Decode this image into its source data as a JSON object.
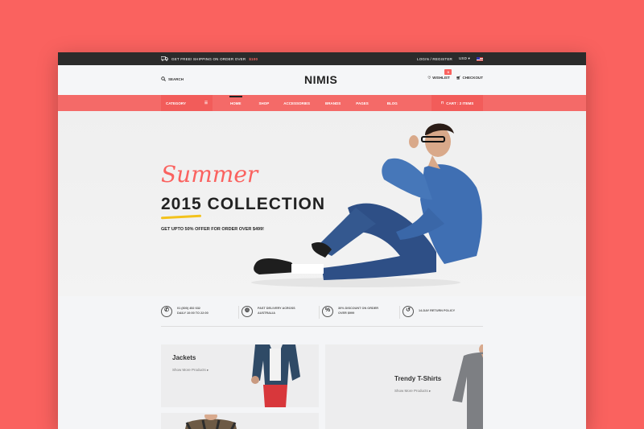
{
  "topbar": {
    "shipping_text": "GET FREE! SHIPPING ON ORDER OVER",
    "shipping_amount": "$100",
    "login_label": "LOGIN / REGISTER",
    "currency": "USD ▾"
  },
  "header": {
    "search_label": "SEARCH",
    "logo": "NIMIS",
    "wishlist_label": "WISHLIST",
    "wishlist_count": "0",
    "checkout_label": "CHECKOUT"
  },
  "nav": {
    "category_label": "CATEGORY",
    "links": [
      "HOME",
      "SHOP",
      "ACCESSORIES",
      "BRANDS",
      "PAGES",
      "BLOG"
    ],
    "cart_label": "CART : 2 ITEMS"
  },
  "hero": {
    "script_title": "Summer",
    "title": "2015 COLLECTION",
    "offer": "GET UPTO 50% OFFER FOR ORDER OVER $499!"
  },
  "features": [
    {
      "icon": "phone-icon",
      "line1": "01 (800) 452 632",
      "line2": "DAILY 10:00 TO 22:00"
    },
    {
      "icon": "globe-icon",
      "line1": "FAST DELIVERY ACROSS",
      "line2": "AUSTRALIA"
    },
    {
      "icon": "discount-icon",
      "line1": "30% DISCOUNT ON ORDER",
      "line2": "OVER $999"
    },
    {
      "icon": "return-icon",
      "line1": "14-DAY RETURN POLICY",
      "line2": ""
    }
  ],
  "products": [
    {
      "title": "Jackets",
      "link": "Show More Products ▸"
    },
    {
      "title": "Trendy T-Shirts",
      "link": "Show More Products ▸"
    }
  ],
  "colors": {
    "accent": "#fa625f",
    "nav": "#f46a68",
    "dark": "#2b2b2b"
  }
}
